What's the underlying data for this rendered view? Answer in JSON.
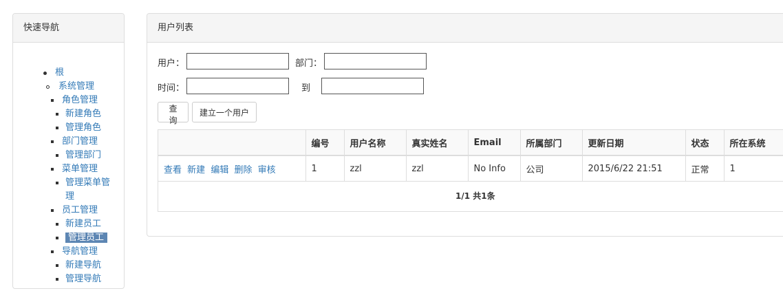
{
  "nav": {
    "title": "快速导航",
    "items": [
      {
        "label": "根",
        "level": 0
      },
      {
        "label": "系统管理",
        "level": 1
      },
      {
        "label": "角色管理",
        "level": 2
      },
      {
        "label": "新建角色",
        "level": 3
      },
      {
        "label": "管理角色",
        "level": 3
      },
      {
        "label": "部门管理",
        "level": 2
      },
      {
        "label": "管理部门",
        "level": 3
      },
      {
        "label": "菜单管理",
        "level": 2
      },
      {
        "label": "管理菜单管",
        "label2": "理",
        "level": 3
      },
      {
        "label": "员工管理",
        "level": 2
      },
      {
        "label": "新建员工",
        "level": 3
      },
      {
        "label": "管理员工",
        "level": 2,
        "active": true
      },
      {
        "label": "导航管理",
        "level": 2
      },
      {
        "label": "新建导航",
        "level": 3
      },
      {
        "label": "管理导航",
        "level": 3
      }
    ]
  },
  "main": {
    "title": "用户列表",
    "filters": {
      "user_label": "用户：",
      "user_value": "",
      "dept_label": "部门：",
      "dept_value": "",
      "time_label": "时间：",
      "time_from": "",
      "to_label": "到",
      "time_to": ""
    },
    "buttons": {
      "search": "查询",
      "create_user": "建立一个用户"
    },
    "table": {
      "columns": [
        "",
        "编号",
        "用户名称",
        "真实姓名",
        "Email",
        "所属部门",
        "更新日期",
        "状态",
        "所在系统"
      ],
      "rows": [
        {
          "ops": [
            "查看",
            "新建",
            "编辑",
            "删除",
            "审核"
          ],
          "id": "1",
          "username": "zzl",
          "realname": "zzl",
          "email": "No Info",
          "dept": "公司",
          "updated": "2015/6/22 21:51",
          "status": "正常",
          "system": "1"
        }
      ],
      "pager": "1/1 共1条"
    }
  },
  "colors": {
    "link": "#337ab7",
    "active_bg": "#5d86b3",
    "border": "#dddddd",
    "heading_bg": "#f5f5f5"
  }
}
